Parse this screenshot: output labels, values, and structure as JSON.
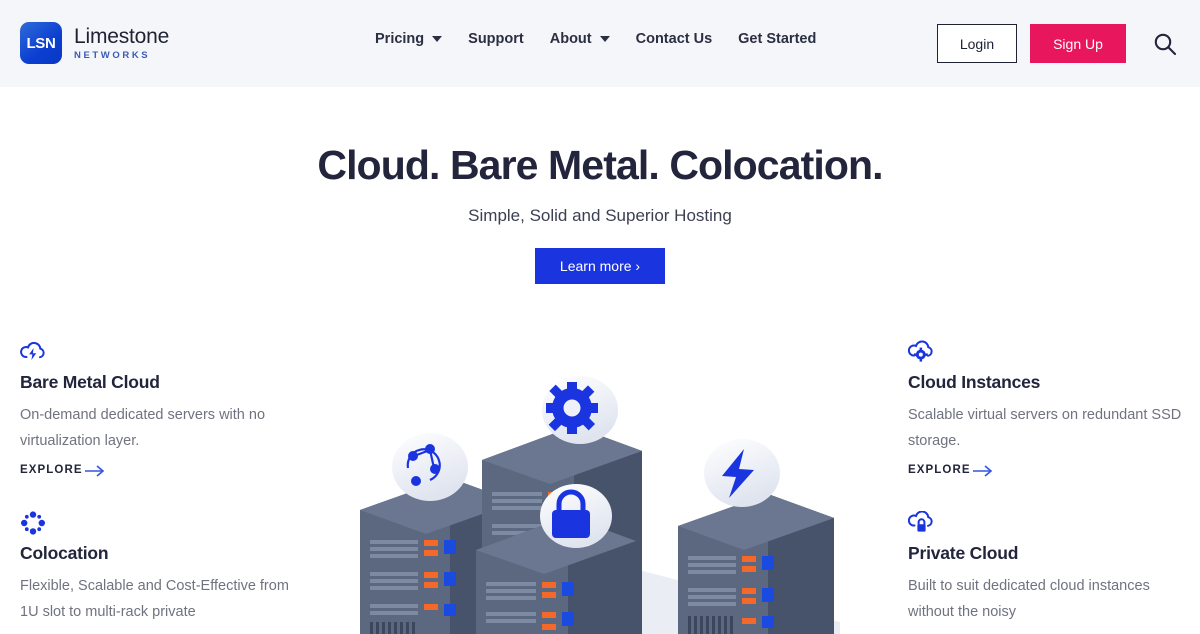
{
  "header": {
    "logo": {
      "mark_text": "LSN",
      "name": "Limestone",
      "sub": "NETWORKS"
    },
    "nav": [
      {
        "label": "Pricing",
        "has_caret": true
      },
      {
        "label": "Support",
        "has_caret": false
      },
      {
        "label": "About",
        "has_caret": true
      },
      {
        "label": "Contact Us",
        "has_caret": false
      },
      {
        "label": "Get Started",
        "has_caret": false
      }
    ],
    "login_label": "Login",
    "signup_label": "Sign Up",
    "search_icon": "search-icon",
    "bg_color": "#f4f6f9",
    "signup_color": "#e8175d"
  },
  "hero": {
    "title": "Cloud. Bare Metal. Colocation.",
    "subtitle": "Simple, Solid and Superior Hosting",
    "cta_label": "Learn more ›",
    "cta_color": "#1a34e0"
  },
  "features": {
    "left": [
      {
        "icon": "cloud-lightning-icon",
        "title": "Bare Metal Cloud",
        "desc": "On-demand dedicated servers with no virtualization layer.",
        "link_label": "EXPLORE"
      },
      {
        "icon": "network-nodes-icon",
        "title": "Colocation",
        "desc": "Flexible, Scalable and Cost-Effective from 1U slot to multi-rack private",
        "link_label": ""
      }
    ],
    "right": [
      {
        "icon": "cloud-gear-icon",
        "title": "Cloud Instances",
        "desc": "Scalable virtual servers on redundant SSD storage.",
        "link_label": "EXPLORE"
      },
      {
        "icon": "cloud-lock-icon",
        "title": "Private Cloud",
        "desc": "Built to suit dedicated cloud instances without the noisy",
        "link_label": ""
      }
    ]
  },
  "illustration": {
    "name": "isometric-server-racks-illustration",
    "badges": [
      "network-nodes-icon",
      "gear-icon",
      "lightning-icon",
      "lock-icon"
    ],
    "accent_color": "#1a34e0",
    "rack_color": "#5a6780"
  }
}
